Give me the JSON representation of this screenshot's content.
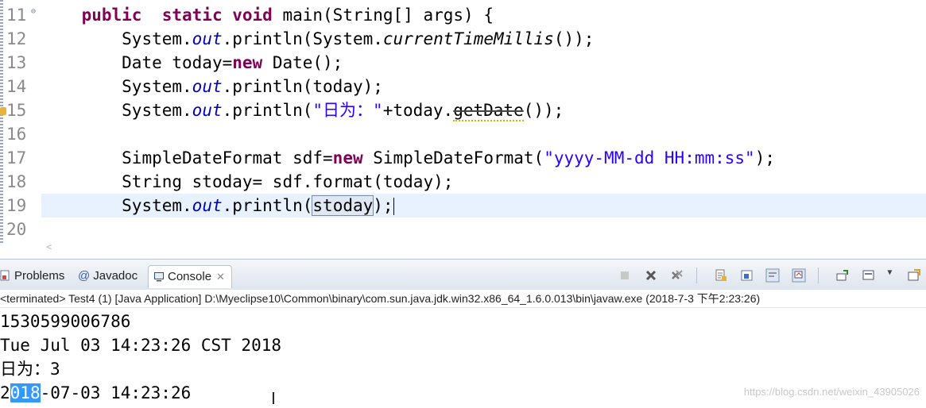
{
  "editor": {
    "line_numbers": [
      "11",
      "12",
      "13",
      "14",
      "15",
      "16",
      "17",
      "18",
      "19",
      "20"
    ],
    "lines": [
      {
        "indent": "    ",
        "parts": [
          [
            "kw",
            "public"
          ],
          [
            "",
            "  "
          ],
          [
            "kw",
            "static"
          ],
          [
            "",
            " "
          ],
          [
            "kw",
            "void"
          ],
          [
            "",
            " main(String[] args) {"
          ]
        ]
      },
      {
        "indent": "        ",
        "parts": [
          [
            "",
            "System."
          ],
          [
            "fld",
            "out"
          ],
          [
            "",
            ".println(System."
          ],
          [
            "ital",
            "currentTimeMillis"
          ],
          [
            "",
            "());"
          ]
        ]
      },
      {
        "indent": "        ",
        "parts": [
          [
            "",
            "Date today="
          ],
          [
            "kw",
            "new"
          ],
          [
            "",
            " Date();"
          ]
        ]
      },
      {
        "indent": "        ",
        "parts": [
          [
            "",
            "System."
          ],
          [
            "fld",
            "out"
          ],
          [
            "",
            ".println(today);"
          ]
        ]
      },
      {
        "indent": "        ",
        "parts": [
          [
            "",
            "System."
          ],
          [
            "fld",
            "out"
          ],
          [
            "",
            ".println("
          ],
          [
            "str",
            "\"日为：\""
          ],
          [
            "",
            "+today."
          ],
          [
            "depr",
            "getDate"
          ],
          [
            "",
            "());"
          ]
        ]
      },
      {
        "indent": "",
        "parts": []
      },
      {
        "indent": "        ",
        "parts": [
          [
            "",
            "SimpleDateFormat sdf="
          ],
          [
            "kw",
            "new"
          ],
          [
            "",
            " SimpleDateFormat("
          ],
          [
            "str",
            "\"yyyy-MM-dd HH:mm:ss\""
          ],
          [
            "",
            ");"
          ]
        ]
      },
      {
        "indent": "        ",
        "parts": [
          [
            "",
            "String stoday= sdf.format(today);"
          ]
        ]
      },
      {
        "indent": "        ",
        "parts": [
          [
            "",
            "System."
          ],
          [
            "fld",
            "out"
          ],
          [
            "",
            ".println("
          ],
          [
            "sel",
            "stoday"
          ],
          [
            "",
            ");"
          ]
        ]
      },
      {
        "indent": "",
        "parts": []
      }
    ]
  },
  "views": {
    "tabs": {
      "problems": "Problems",
      "javadoc_prefix": "@",
      "javadoc": "Javadoc",
      "console": "Console"
    },
    "status": "<terminated> Test4 (1) [Java Application] D:\\Myeclipse10\\Common\\binary\\com.sun.java.jdk.win32.x86_64_1.6.0.013\\bin\\javaw.exe (2018-7-3 下午2:23:26)",
    "output": [
      "1530599006786",
      "Tue Jul 03 14:23:26 CST 2018",
      "日为：3"
    ],
    "last_line": {
      "pre": "2",
      "highlight": "018",
      "post": "-07-03 14:23:26"
    },
    "toolbar_icons": [
      "terminate-icon",
      "remove-launch-icon",
      "remove-all-terminated-icon",
      "clear-console-icon",
      "scroll-lock-icon",
      "word-wrap-icon",
      "show-when-stdout-icon",
      "pin-console-icon",
      "display-selected-console-icon",
      "open-console-icon",
      "view-menu-icon"
    ]
  },
  "watermark": "https://blog.csdn.net/weixin_43905026"
}
